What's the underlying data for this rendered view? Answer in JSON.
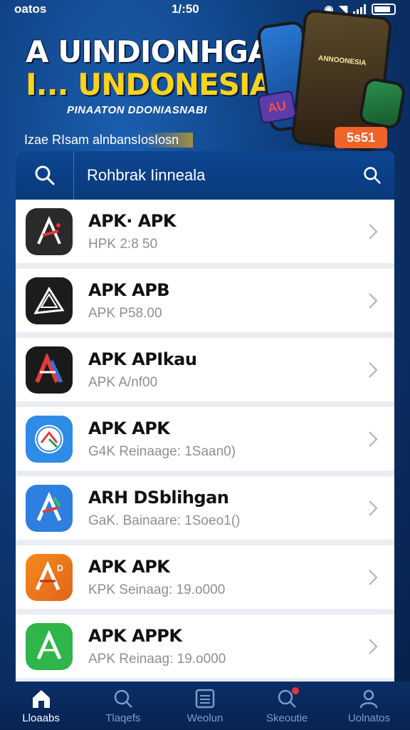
{
  "status_bar": {
    "left_text": "oatos",
    "time": "1/:50"
  },
  "banner": {
    "title_line1": "A UINDIONHGAN",
    "title_line2": "I... UNDONESIAN",
    "subtitle": "PINAATON DDONIASNABI",
    "caption": "Izae RIsam alnbansIosIosn",
    "phone_label": "ANNOONESIA",
    "badge_right": "5s51",
    "badge_left": "AU"
  },
  "search": {
    "placeholder": "Rohbrak Iinneala"
  },
  "apps": [
    {
      "name": "APK· APK",
      "meta": "HPK  2:8 50",
      "icon": "apk-red-black-icon",
      "color": "#2a2a2a"
    },
    {
      "name": "APK  APB",
      "meta": "APK  P58.00",
      "icon": "apk-outline-icon",
      "color": "#1c1c1c"
    },
    {
      "name": "APK APIkau",
      "meta": "APK  A/nf00",
      "icon": "apk-red-blue-icon",
      "color": "#1a1a1a"
    },
    {
      "name": "APK APK",
      "meta": "G4K  Reinaage: 1Saan0)",
      "icon": "apk-compass-icon",
      "color": "#2e8be6"
    },
    {
      "name": "ARH DSblihgan",
      "meta": "GaK. Bainaare: 1Soeo1()",
      "icon": "apk-blue-icon",
      "color": "#2d7fe0"
    },
    {
      "name": "APK APK",
      "meta": "KPK  Seinaag: 19.o000",
      "icon": "apk-orange-icon",
      "color": "#f07a1c"
    },
    {
      "name": "APK APPK",
      "meta": "APK  Reinaag: 19.o000",
      "icon": "apk-green-icon",
      "color": "#2fb54a"
    }
  ],
  "nav": [
    {
      "label": "Lloaabs",
      "icon": "home-icon",
      "active": true
    },
    {
      "label": "Tlaqefs",
      "icon": "search-icon",
      "active": false
    },
    {
      "label": "Weolun",
      "icon": "list-icon",
      "active": false
    },
    {
      "label": "Skeoutie",
      "icon": "notification-search-icon",
      "active": false
    },
    {
      "label": "Uolnatos",
      "icon": "user-icon",
      "active": false
    }
  ],
  "colors": {
    "accent": "#0c4590",
    "title_yellow": "#ffd21a",
    "badge_orange": "#f2632a",
    "notification_red": "#e8323c"
  }
}
